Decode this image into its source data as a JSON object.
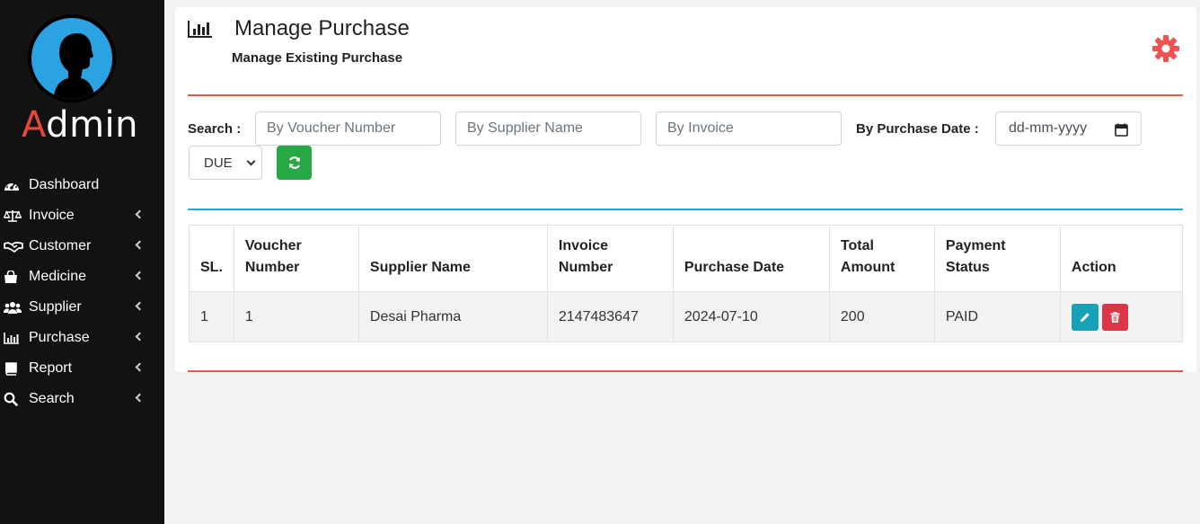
{
  "sidebar": {
    "brand_first": "A",
    "brand_rest": "dmin",
    "items": [
      {
        "label": "Dashboard",
        "icon": "dashboard-icon",
        "has_submenu": false
      },
      {
        "label": "Invoice",
        "icon": "balance-scale-icon",
        "has_submenu": true
      },
      {
        "label": "Customer",
        "icon": "handshake-icon",
        "has_submenu": true
      },
      {
        "label": "Medicine",
        "icon": "shopping-bag-icon",
        "has_submenu": true
      },
      {
        "label": "Supplier",
        "icon": "users-icon",
        "has_submenu": true
      },
      {
        "label": "Purchase",
        "icon": "bar-chart-icon",
        "has_submenu": true
      },
      {
        "label": "Report",
        "icon": "book-icon",
        "has_submenu": true
      },
      {
        "label": "Search",
        "icon": "search-icon",
        "has_submenu": true
      }
    ]
  },
  "header": {
    "title": "Manage Purchase",
    "subtitle": "Manage Existing Purchase",
    "title_icon": "bar-chart-icon",
    "settings_icon": "gear-icon"
  },
  "filters": {
    "search_label": "Search :",
    "voucher_placeholder": "By Voucher Number",
    "supplier_placeholder": "By Supplier Name",
    "invoice_placeholder": "By Invoice",
    "date_label": "By Purchase Date :",
    "date_placeholder": "dd-mm-yyyy",
    "status_selected": "DUE"
  },
  "table": {
    "headers": [
      "SL.",
      "Voucher Number",
      "Supplier Name",
      "Invoice Number",
      "Purchase Date",
      "Total Amount",
      "Payment Status",
      "Action"
    ],
    "rows": [
      {
        "sl": "1",
        "voucher": "1",
        "supplier": "Desai Pharma",
        "invoice": "2147483647",
        "date": "2024-07-10",
        "amount": "200",
        "status": "PAID"
      }
    ]
  },
  "colors": {
    "sidebar_bg": "#121212",
    "brand_accent": "#e8473b",
    "avatar_blue": "#2ba3e3",
    "red_rule": "#e8584e",
    "blue_rule": "#26a6e0",
    "refresh_green": "#28a745",
    "edit_teal": "#17a2b8",
    "delete_red": "#dc3545",
    "gear_red": "#ef5350"
  }
}
